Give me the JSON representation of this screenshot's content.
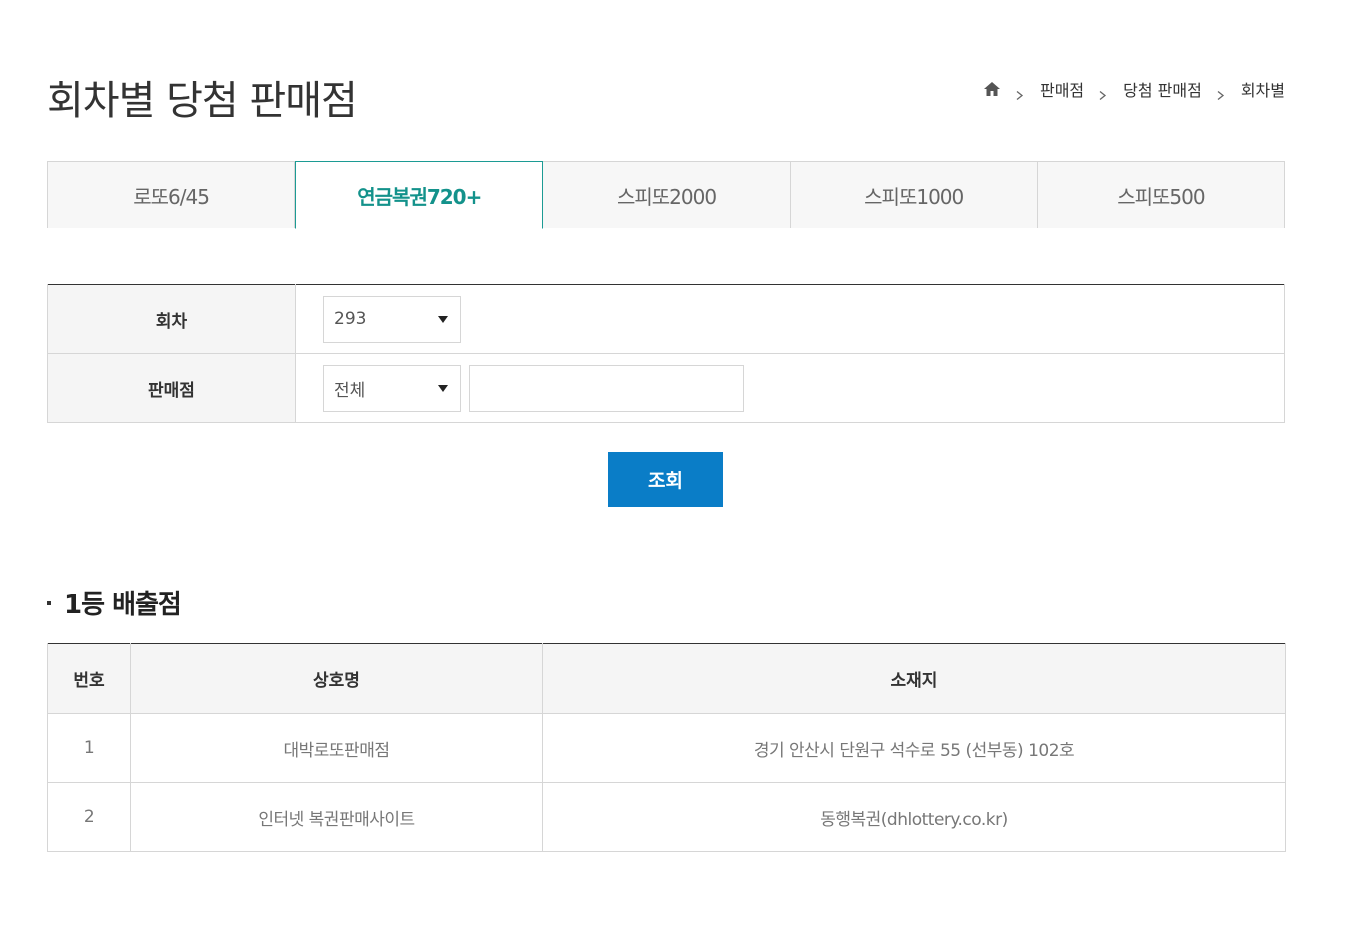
{
  "page_title": "회차별 당첨 판매점",
  "breadcrumb": {
    "home_icon": "home-icon",
    "items": [
      "판매점",
      "당첨 판매점",
      "회차별"
    ]
  },
  "tabs": [
    {
      "label": "로또6/45",
      "active": false
    },
    {
      "label": "연금복권720+",
      "active": true
    },
    {
      "label": "스피또2000",
      "active": false
    },
    {
      "label": "스피또1000",
      "active": false
    },
    {
      "label": "스피또500",
      "active": false
    }
  ],
  "search_form": {
    "round_label": "회차",
    "round_value": "293",
    "store_label": "판매점",
    "store_filter_value": "전체",
    "store_search_value": ""
  },
  "search_button": "조회",
  "section_title": "1등 배출점",
  "results": {
    "headers": [
      "번호",
      "상호명",
      "소재지"
    ],
    "rows": [
      [
        "1",
        "대박로또판매점",
        "경기 안산시 단원구 석수로 55 (선부동) 102호"
      ],
      [
        "2",
        "인터넷 복권판매사이트",
        "동행복권(dhlottery.co.kr)"
      ]
    ]
  },
  "colors": {
    "accent_teal": "#1c9b94",
    "button_blue": "#0a7dc7"
  }
}
